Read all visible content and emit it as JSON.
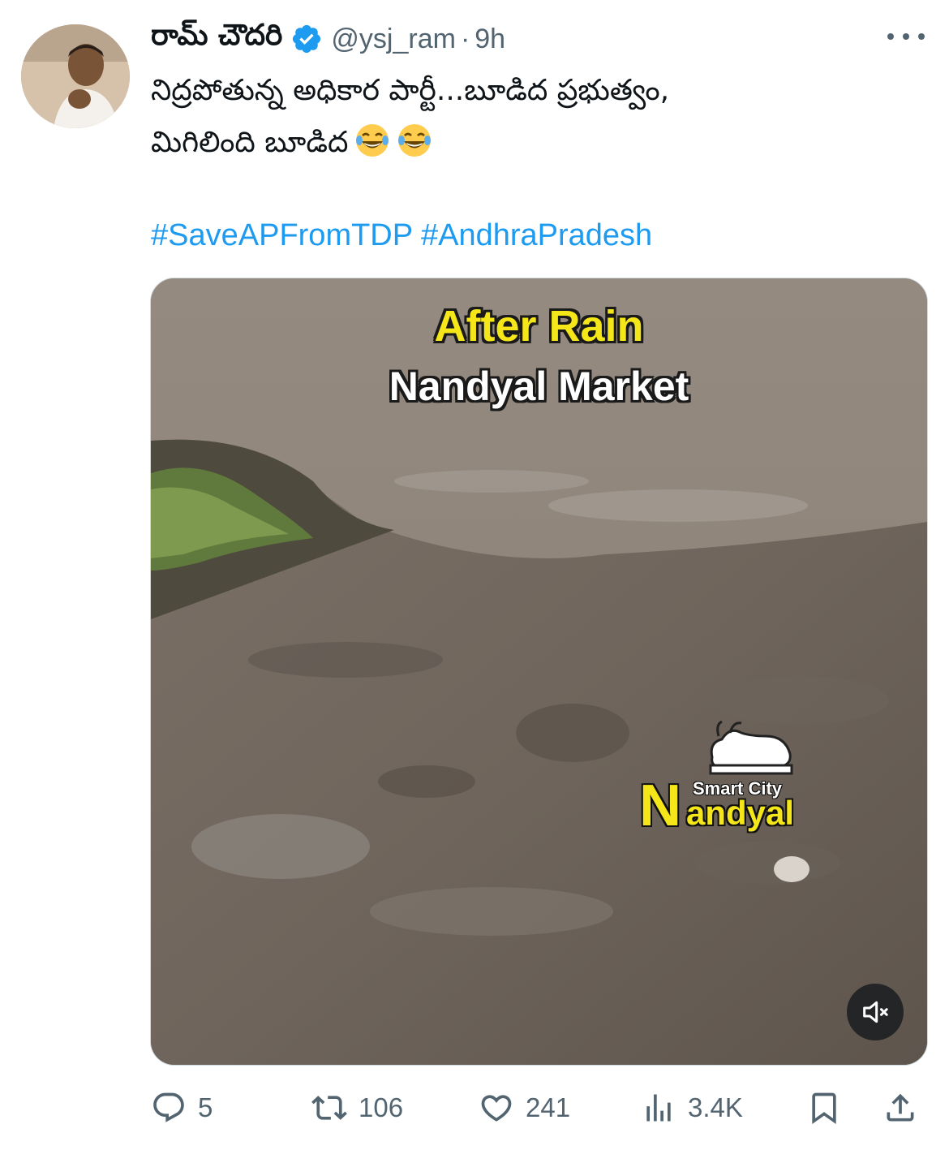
{
  "author": {
    "display_name": "రామ్ చౌదరి",
    "handle": "@ysj_ram",
    "separator": "·",
    "time": "9h",
    "verified_icon": "verified-badge-icon"
  },
  "tweet": {
    "text_line1": "నిద్రపోతున్న అధికార పార్టీ...బూడిద ప్రభుత్వం,",
    "text_line2": "మిగిలింది బూడిద",
    "emoji": "face-with-tears-of-joy",
    "hashtags": [
      "#SaveAPFromTDP",
      "#AndhraPradesh"
    ]
  },
  "media": {
    "overlay_title": "After Rain",
    "overlay_subtitle": "Nandyal Market",
    "watermark_small": "Smart City",
    "watermark_big_letter": "N",
    "watermark_rest": "andyal",
    "mute_icon": "volume-muted-icon"
  },
  "metrics": {
    "replies": "5",
    "reposts": "106",
    "likes": "241",
    "views": "3.4K"
  },
  "colors": {
    "link": "#1d9bf0",
    "secondary": "#536471",
    "verified": "#1d9bf0",
    "overlay_yellow": "#f5e619"
  }
}
